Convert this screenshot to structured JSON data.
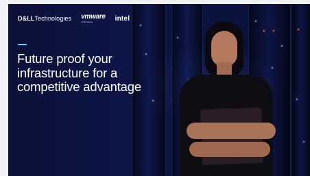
{
  "hero": {
    "brands": {
      "dell_bold": "D&LL",
      "dell_light": "Technologies",
      "vmware": "vmware",
      "vmware_sub": "by Broadcom",
      "intel": "intel"
    },
    "headline": "Future proof your infrastructure for a competitive advantage"
  },
  "colors": {
    "background": "#0d1547",
    "accent": "#6ec6f2",
    "text": "#ffffff"
  }
}
